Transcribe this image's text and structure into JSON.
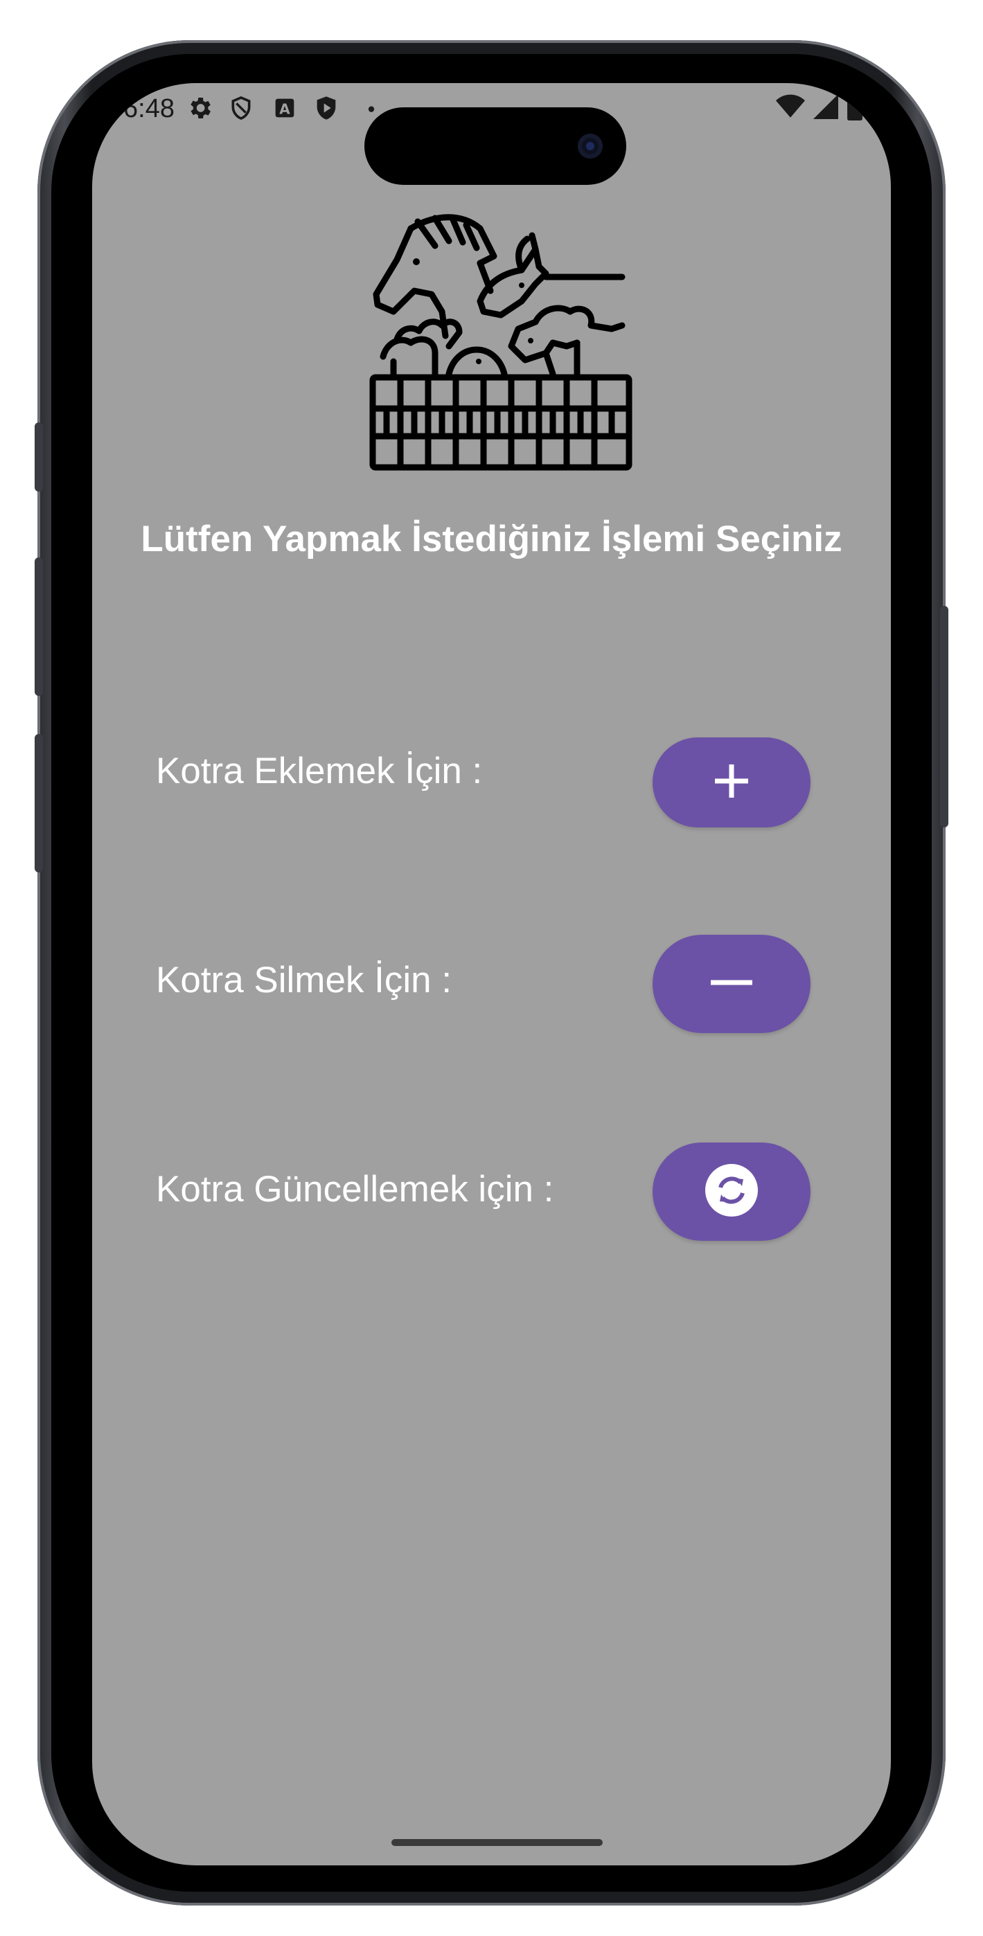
{
  "status_bar": {
    "time": "6:48",
    "left_icons": [
      "gear-icon",
      "shield-outline-icon",
      "a-box-icon",
      "play-shield-icon",
      "dot-icon"
    ],
    "right_icons": [
      "wifi-icon",
      "signal-icon",
      "battery-icon"
    ]
  },
  "logo": {
    "icon": "farm-animals-icon"
  },
  "page": {
    "title": "Lütfen Yapmak İstediğiniz İşlemi Seçiniz"
  },
  "actions": [
    {
      "label": "Kotra Eklemek İçin :",
      "icon": "plus-icon"
    },
    {
      "label": "Kotra Silmek İçin :",
      "icon": "minus-icon"
    },
    {
      "label": "Kotra Güncellemek için :",
      "icon": "sync-icon"
    }
  ],
  "colors": {
    "screen_background": "#a0a0a0",
    "button_background": "#6b52a6",
    "text": "#ffffff"
  }
}
